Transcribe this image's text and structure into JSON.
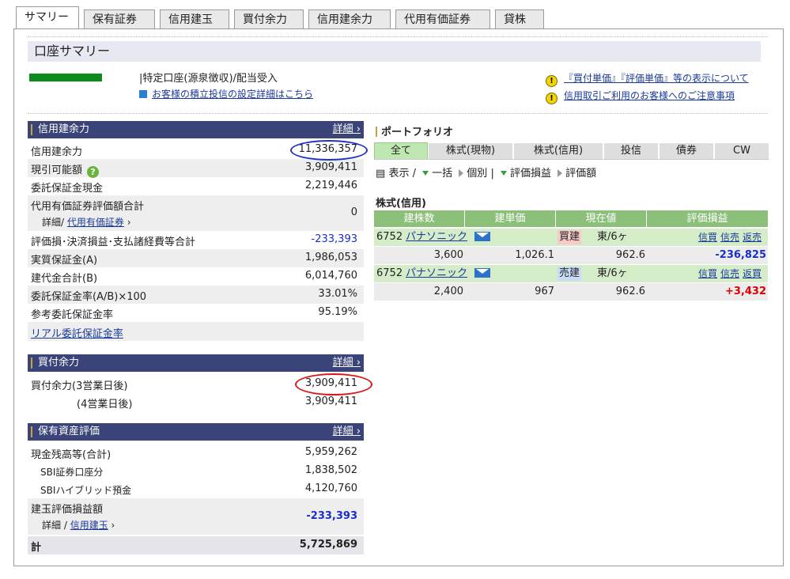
{
  "tabs": [
    "サマリー",
    "保有証券",
    "信用建玉",
    "買付余力",
    "信用建余力",
    "代用有価証券",
    "貸株"
  ],
  "page_title": "口座サマリー",
  "account": {
    "type_text": "特定口座(源泉徴収)/配当受入",
    "link_text": "お客様の積立投信の設定詳細はこちら"
  },
  "notices": [
    "『買付単価』『評価単価』等の表示について",
    "信用取引ご利用のお客様へのご注意事項"
  ],
  "credit": {
    "title": "信用建余力",
    "detail": "詳細",
    "rows": [
      {
        "label": "信用建余力",
        "value": "11,336,357"
      },
      {
        "label": "現引可能額",
        "value": "3,909,411"
      },
      {
        "label": "委託保証金現金",
        "value": "2,219,446"
      },
      {
        "label": "代用有価証券評価額合計",
        "value": "0",
        "sub_prefix": "詳細/ ",
        "sub_link": "代用有価証券"
      },
      {
        "label": "評価損･決済損益･支払諸経費等合計",
        "value": "-233,393"
      },
      {
        "label": "実質保証金(A)",
        "value": "1,986,053"
      },
      {
        "label": "建代金合計(B)",
        "value": "6,014,760"
      },
      {
        "label": "委託保証金率(A/B)×100",
        "value": "33.01%"
      },
      {
        "label": "参考委託保証金率",
        "value": "95.19%"
      }
    ],
    "real_link": "リアル委託保証金率"
  },
  "buying": {
    "title": "買付余力",
    "detail": "詳細",
    "rows": [
      {
        "label": "買付余力(3営業日後)",
        "value": "3,909,411"
      },
      {
        "label": "(4営業日後)",
        "value": "3,909,411"
      }
    ]
  },
  "assets": {
    "title": "保有資産評価",
    "detail": "詳細",
    "rows": [
      {
        "label": "現金残高等(合計)",
        "value": "5,959,262"
      },
      {
        "label": "SBI証券口座分",
        "value": "1,838,502"
      },
      {
        "label": "SBIハイブリッド預金",
        "value": "4,120,760"
      },
      {
        "label": "建玉評価損益額",
        "value": "-233,393",
        "sub_prefix": "詳細 / ",
        "sub_link": "信用建玉"
      },
      {
        "label": "計",
        "value": "5,725,869"
      }
    ]
  },
  "portfolio": {
    "title": "ポートフォリオ",
    "tabs": [
      "全て",
      "株式(現物)",
      "株式(信用)",
      "投信",
      "債券",
      "CW"
    ],
    "view": {
      "label": "表示",
      "sep": "/",
      "opt1": "一括",
      "opt2": "個別",
      "sep2": "|",
      "opt3": "評価損益",
      "opt4": "評価額"
    },
    "section": "株式(信用)",
    "headers": [
      "建株数",
      "建単価",
      "現在値",
      "評価損益"
    ],
    "positions": [
      {
        "code": "6752",
        "name": "パナソニック",
        "side": "買建",
        "market": "東/6ヶ",
        "actions": [
          "信買",
          "信売",
          "返売"
        ],
        "qty": "3,600",
        "price": "1,026.1",
        "current": "962.6",
        "pnl": "-236,825"
      },
      {
        "code": "6752",
        "name": "パナソニック",
        "side": "売建",
        "market": "東/6ヶ",
        "actions": [
          "信買",
          "信売",
          "返買"
        ],
        "qty": "2,400",
        "price": "967",
        "current": "962.6",
        "pnl": "+3,432"
      }
    ]
  }
}
